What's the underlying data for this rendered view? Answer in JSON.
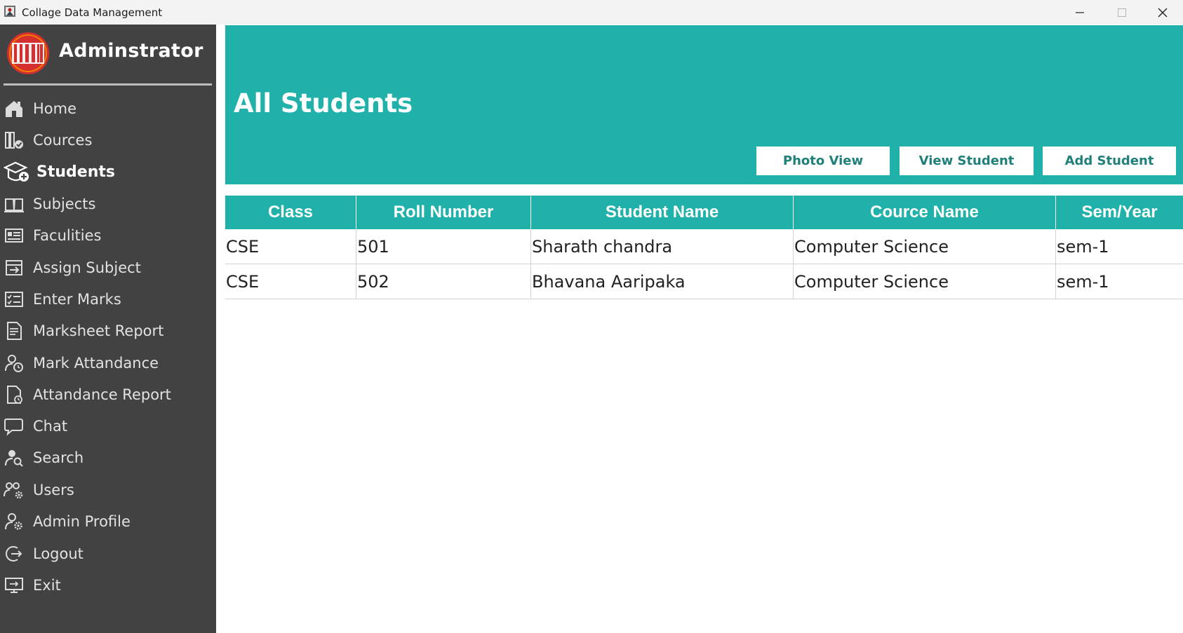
{
  "window": {
    "title": "Collage Data Management"
  },
  "sidebar": {
    "brand": "Adminstrator",
    "items": [
      {
        "label": "Home",
        "icon": "home-icon"
      },
      {
        "label": "Cources",
        "icon": "books-check-icon"
      },
      {
        "label": "Students",
        "icon": "graduate-add-icon",
        "active": true
      },
      {
        "label": "Subjects",
        "icon": "open-book-icon"
      },
      {
        "label": "Faculities",
        "icon": "id-card-icon"
      },
      {
        "label": "Assign Subject",
        "icon": "assign-icon"
      },
      {
        "label": "Enter Marks",
        "icon": "checklist-icon"
      },
      {
        "label": "Marksheet Report",
        "icon": "report-icon"
      },
      {
        "label": "Mark Attandance",
        "icon": "user-clock-icon"
      },
      {
        "label": "Attandance Report",
        "icon": "document-clock-icon"
      },
      {
        "label": "Chat",
        "icon": "chat-icon"
      },
      {
        "label": "Search",
        "icon": "user-search-icon"
      },
      {
        "label": "Users",
        "icon": "users-gear-icon"
      },
      {
        "label": "Admin Profile",
        "icon": "user-gear-icon"
      },
      {
        "label": "Logout",
        "icon": "logout-icon"
      },
      {
        "label": "Exit",
        "icon": "monitor-exit-icon"
      }
    ]
  },
  "header": {
    "title": "All Students",
    "buttons": {
      "photo_view": "Photo View",
      "view_student": "View Student",
      "add_student": "Add Student"
    }
  },
  "table": {
    "columns": [
      "Class",
      "Roll Number",
      "Student Name",
      "Cource Name",
      "Sem/Year"
    ],
    "rows": [
      [
        "CSE",
        "501",
        "Sharath chandra",
        "Computer Science",
        "sem-1"
      ],
      [
        "CSE",
        "502",
        "Bhavana Aaripaka",
        "Computer Science",
        "sem-1"
      ]
    ]
  },
  "colors": {
    "accent": "#20b2aa",
    "sidebar": "#424242",
    "logo_red": "#d32f2f"
  }
}
